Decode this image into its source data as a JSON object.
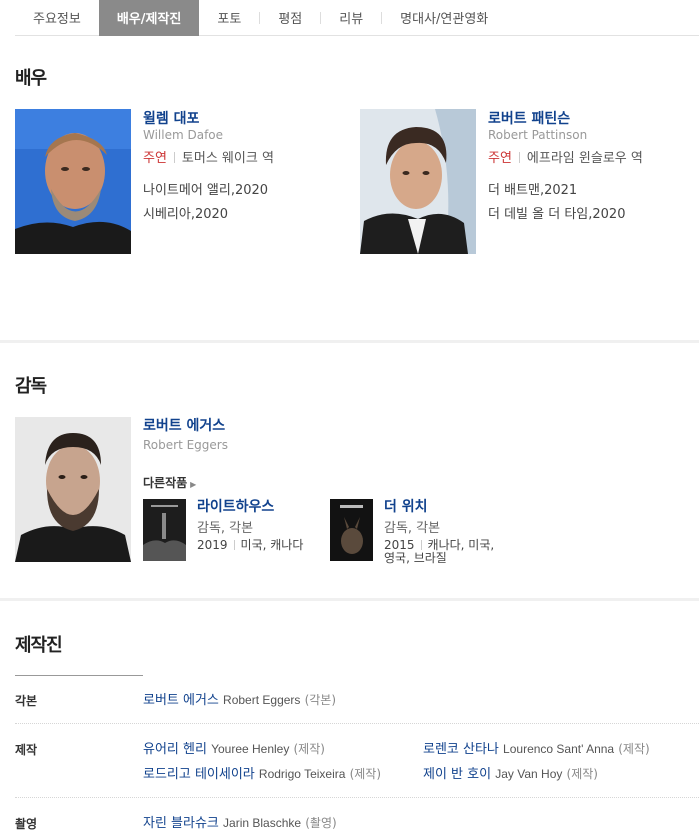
{
  "tabs": [
    {
      "label": "주요정보",
      "active": false
    },
    {
      "label": "배우/제작진",
      "active": true
    },
    {
      "label": "포토",
      "active": false
    },
    {
      "label": "평점",
      "active": false
    },
    {
      "label": "리뷰",
      "active": false
    },
    {
      "label": "명대사/연관영화",
      "active": false
    }
  ],
  "actors_section": {
    "title": "배우",
    "actors": [
      {
        "name_kr": "윌렘 대포",
        "name_en": "Willem Dafoe",
        "role_type": "주연",
        "role_name": "토머스 웨이크 역",
        "works": [
          "나이트메어 앨리,2020",
          "시베리아,2020"
        ]
      },
      {
        "name_kr": "로버트 패틴슨",
        "name_en": "Robert Pattinson",
        "role_type": "주연",
        "role_name": "에프라임 윈슬로우 역",
        "works": [
          "더 배트맨,2021",
          "더 데빌 올 더 타임,2020"
        ]
      }
    ]
  },
  "director_section": {
    "title": "감독",
    "name_kr": "로버트 에거스",
    "name_en": "Robert Eggers",
    "other_works_label": "다른작품",
    "other_works": [
      {
        "title": "라이트하우스",
        "role": "감독, 각본",
        "year": "2019",
        "country": "미국, 캐나다"
      },
      {
        "title": "더 위치",
        "role": "감독, 각본",
        "year": "2015",
        "country": "캐나다, 미국, 영국, 브라질"
      }
    ]
  },
  "crew_section": {
    "title": "제작진",
    "rows": [
      {
        "label": "각본",
        "entries": [
          {
            "kr": "로버트 에거스",
            "en": "Robert Eggers",
            "paren": "(각본)"
          }
        ]
      },
      {
        "label": "제작",
        "entries": [
          {
            "kr": "유어리 헨리",
            "en": "Youree Henley",
            "paren": "(제작)"
          },
          {
            "kr": "로렌코 산타나",
            "en": "Lourenco Sant' Anna",
            "paren": "(제작)"
          },
          {
            "kr": "로드리고 테이세이라",
            "en": "Rodrigo Teixeira",
            "paren": "(제작)"
          },
          {
            "kr": "제이 반 호이",
            "en": "Jay Van Hoy",
            "paren": "(제작)"
          }
        ]
      },
      {
        "label": "촬영",
        "entries": [
          {
            "kr": "자린 블라슈크",
            "en": "Jarin Blaschke",
            "paren": "(촬영)"
          }
        ]
      }
    ]
  },
  "colors": {
    "link": "#11428d",
    "role": "#cc3333",
    "tab_active": "#8a8a8a"
  }
}
